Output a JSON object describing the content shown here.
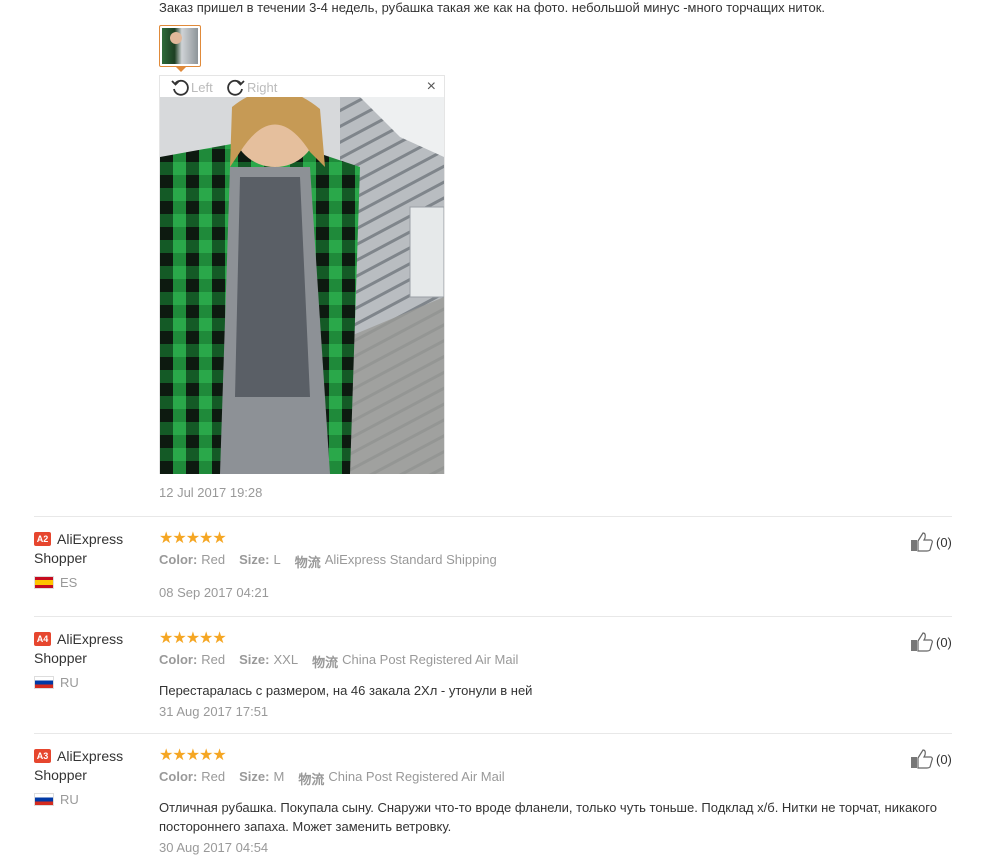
{
  "top_review": {
    "text": "Заказ пришел в течении 3-4 недель, рубашка такая же как на фото. небольшой минус -много торчащих ниток.",
    "viewer": {
      "rotate_left": "Left",
      "rotate_right": "Right",
      "close": "×"
    },
    "date": "12 Jul 2017 19:28"
  },
  "reviews": [
    {
      "badge": "A2",
      "user": "AliExpress Shopper",
      "country": "ES",
      "stars": "★★★★★",
      "color_label": "Color:",
      "color": "Red",
      "size_label": "Size:",
      "size": "L",
      "shipping_label": "物流",
      "shipping": "AliExpress Standard Shipping",
      "text": "",
      "date": "08 Sep 2017 04:21",
      "likes": "(0)"
    },
    {
      "badge": "A4",
      "user": "AliExpress Shopper",
      "country": "RU",
      "stars": "★★★★★",
      "color_label": "Color:",
      "color": "Red",
      "size_label": "Size:",
      "size": "XXL",
      "shipping_label": "物流",
      "shipping": "China Post Registered Air Mail",
      "text": "Перестаралась с размером, на 46 закала 2Хл - утонули в ней",
      "date": "31 Aug 2017 17:51",
      "likes": "(0)"
    },
    {
      "badge": "A3",
      "user": "AliExpress Shopper",
      "country": "RU",
      "stars": "★★★★★",
      "color_label": "Color:",
      "color": "Red",
      "size_label": "Size:",
      "size": "M",
      "shipping_label": "物流",
      "shipping": "China Post Registered Air Mail",
      "text": "Отличная рубашка. Покупала сыну. Снаружи что-то вроде фланели, только чуть тоньше. Подклад х/б. Нитки не торчат, никакого постороннего запаха. Может заменить ветровку.",
      "date": "30 Aug 2017 04:54",
      "likes": "(0)"
    }
  ],
  "colors": {
    "star": "#f5a623",
    "badge": "#e6462e",
    "thumb_border": "#e08a3a"
  }
}
